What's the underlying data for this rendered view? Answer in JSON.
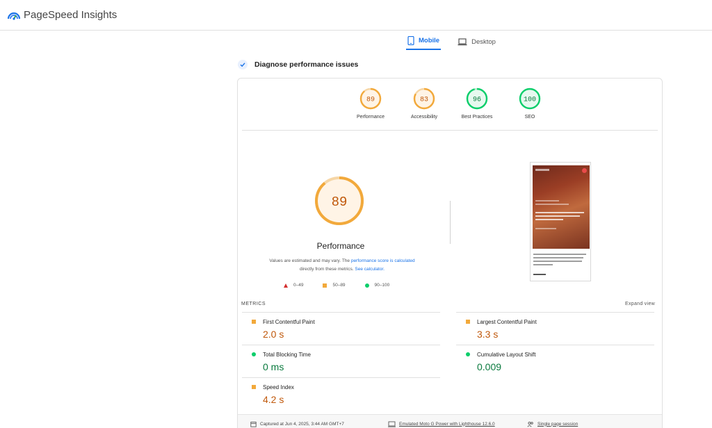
{
  "app": {
    "title": "PageSpeed Insights"
  },
  "tabs": [
    {
      "label": "Mobile",
      "active": true,
      "icon": "phone-icon"
    },
    {
      "label": "Desktop",
      "active": false,
      "icon": "laptop-icon"
    }
  ],
  "diagnose": {
    "title": "Diagnose performance issues"
  },
  "scores": [
    {
      "label": "Performance",
      "value": "89",
      "color": "#f2a93b",
      "fill": "#fff4e6",
      "text": "#c0580b"
    },
    {
      "label": "Accessibility",
      "value": "83",
      "color": "#f2a93b",
      "fill": "#fff4e6",
      "text": "#c0580b"
    },
    {
      "label": "Best Practices",
      "value": "96",
      "color": "#0cce6b",
      "fill": "#e6f9ef",
      "text": "#0a7a3e"
    },
    {
      "label": "SEO",
      "value": "100",
      "color": "#0cce6b",
      "fill": "#e6f9ef",
      "text": "#0a7a3e"
    }
  ],
  "performance": {
    "score": "89",
    "title": "Performance",
    "note_prefix": "Values are estimated and may vary. The ",
    "note_link1": "performance score is calculated",
    "note_mid": " directly from these metrics. ",
    "note_link2": "See calculator."
  },
  "legend": [
    {
      "label": "0–49",
      "shape": "triangle"
    },
    {
      "label": "50–89",
      "shape": "square"
    },
    {
      "label": "90–100",
      "shape": "circle"
    }
  ],
  "metrics": {
    "label": "METRICS",
    "expand_label": "Expand view",
    "items": [
      {
        "name": "First Contentful Paint",
        "value": "2.0 s",
        "status": "average"
      },
      {
        "name": "Largest Contentful Paint",
        "value": "3.3 s",
        "status": "average"
      },
      {
        "name": "Total Blocking Time",
        "value": "0 ms",
        "status": "good"
      },
      {
        "name": "Cumulative Layout Shift",
        "value": "0.009",
        "status": "good"
      },
      {
        "name": "Speed Index",
        "value": "4.2 s",
        "status": "average"
      }
    ]
  },
  "footer": {
    "captured": "Captured at Jun 4, 2025, 3:44 AM GMT+7",
    "device": "Emulated Moto G Power with Lighthouse 12.6.0",
    "session": "Single page session"
  },
  "colors": {
    "accent": "#1a73e8",
    "average": "#f2a93b",
    "average_text": "#c0580b",
    "good": "#0cce6b",
    "good_text": "#0a7a3e",
    "poor": "#d32f2f"
  }
}
